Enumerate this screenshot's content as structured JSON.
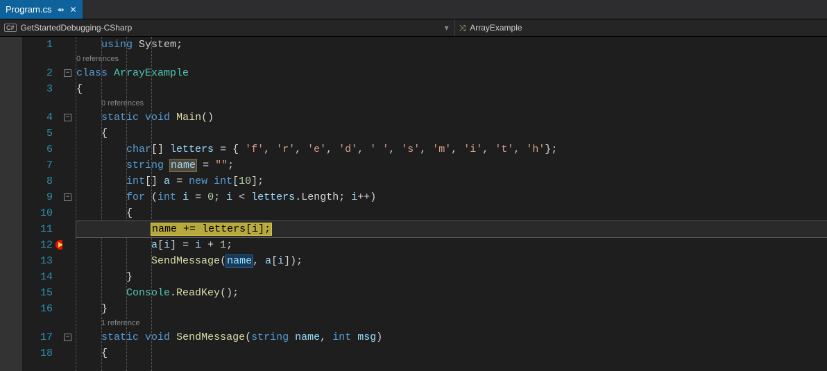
{
  "tab": {
    "label": "Program.cs",
    "pin": "⇴",
    "close": "✕"
  },
  "nav": {
    "left_badge": "C#",
    "left_label": "GetStartedDebugging-CSharp",
    "right_icon": "⤨",
    "right_label": "ArrayExample",
    "dropdown_glyph": "▾"
  },
  "refs": {
    "zero": "0 references",
    "one": "1 reference"
  },
  "fold": {
    "minus": "−"
  },
  "code": {
    "l1": {
      "indent": "    ",
      "kw_using": "using",
      "sp": " ",
      "ns": "System",
      "semi": ";"
    },
    "l2": {
      "kw_class": "class",
      "sp": " ",
      "name": "ArrayExample"
    },
    "l3": {
      "brace": "{"
    },
    "l4": {
      "indent": "    ",
      "kw_static": "static",
      "sp": " ",
      "kw_void": "void",
      "sp2": " ",
      "name": "Main",
      "paren": "()"
    },
    "l5": {
      "indent": "    ",
      "brace": "{"
    },
    "l6": {
      "indent": "        ",
      "type": "char",
      "arr": "[] ",
      "var": "letters",
      "eq": " = { ",
      "c0": "'f'",
      "s0": ", ",
      "c1": "'r'",
      "s1": ", ",
      "c2": "'e'",
      "s2": ", ",
      "c3": "'d'",
      "s3": ", ",
      "c4": "' '",
      "s4": ", ",
      "c5": "'s'",
      "s5": ", ",
      "c6": "'m'",
      "s6": ", ",
      "c7": "'i'",
      "s7": ", ",
      "c8": "'t'",
      "s8": ", ",
      "c9": "'h'",
      "end": "};"
    },
    "l7": {
      "indent": "        ",
      "type": "string",
      "sp": " ",
      "var": "name",
      "eq": " = ",
      "val": "\"\"",
      "semi": ";"
    },
    "l8": {
      "indent": "        ",
      "type": "int",
      "arr": "[] ",
      "var": "a",
      "eq": " = ",
      "kw_new": "new",
      "sp": " ",
      "type2": "int",
      "br": "[",
      "n": "10",
      "end": "];"
    },
    "l9": {
      "indent": "        ",
      "kw_for": "for",
      "open": " (",
      "type": "int",
      "sp": " ",
      "var": "i",
      "eq": " = ",
      "z": "0",
      "semi": "; ",
      "var2": "i",
      "lt": " < ",
      "arr": "letters",
      "dot": ".",
      "prop": "Length",
      "semi2": "; ",
      "var3": "i",
      "inc": "++)"
    },
    "l10": {
      "indent": "        ",
      "brace": "{"
    },
    "l11": {
      "indent": "            ",
      "var": "name",
      "op": " += ",
      "arr": "letters",
      "br": "[",
      "idx": "i",
      "end": "];"
    },
    "l12": {
      "indent": "            ",
      "arr": "a",
      "br": "[",
      "idx": "i",
      "close": "] = ",
      "var": "i",
      "plus": " + ",
      "one": "1",
      "semi": ";"
    },
    "l13": {
      "indent": "            ",
      "fn": "SendMessage",
      "open": "(",
      "arg1": "name",
      "comma": ", ",
      "arr": "a",
      "br": "[",
      "idx": "i",
      "end": "]);"
    },
    "l14": {
      "indent": "        ",
      "brace": "}"
    },
    "l15": {
      "indent": "        ",
      "cls": "Console",
      "dot": ".",
      "fn": "ReadKey",
      "paren": "();"
    },
    "l16": {
      "indent": "    ",
      "brace": "}"
    },
    "l17": {
      "indent": "    ",
      "kw_static": "static",
      "sp": " ",
      "kw_void": "void",
      "sp2": " ",
      "name": "SendMessage",
      "open": "(",
      "type1": "string",
      "sp3": " ",
      "arg1": "name",
      "comma": ", ",
      "type2": "int",
      "sp4": " ",
      "arg2": "msg",
      "close": ")"
    },
    "l18": {
      "indent": "    ",
      "brace": "{"
    }
  },
  "lines": [
    "1",
    "2",
    "3",
    "4",
    "5",
    "6",
    "7",
    "8",
    "9",
    "10",
    "11",
    "12",
    "13",
    "14",
    "15",
    "16",
    "17",
    "18"
  ]
}
